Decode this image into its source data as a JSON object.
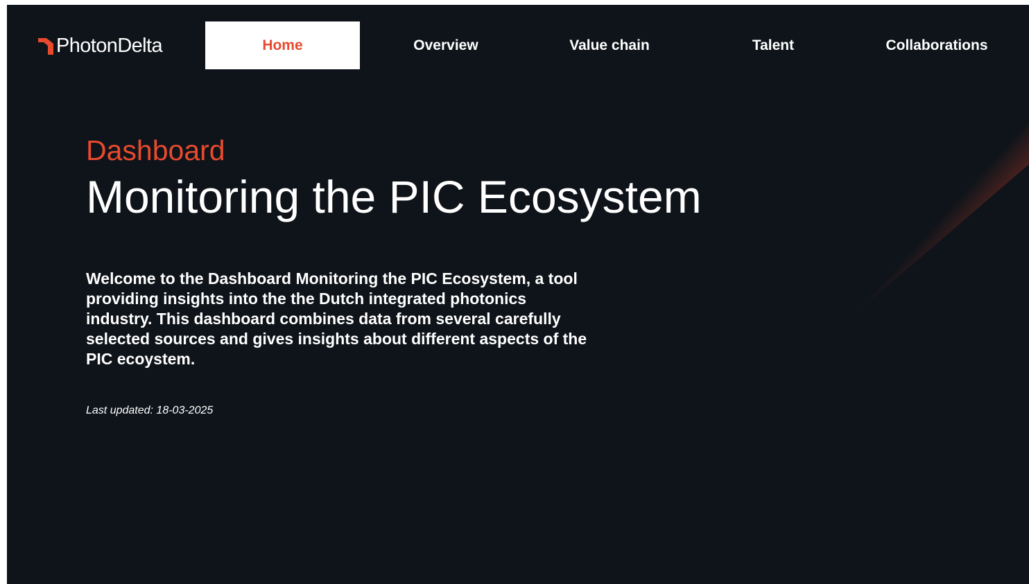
{
  "brand": {
    "logo_text": "PhotonDelta",
    "accent_color": "#e84a2e",
    "background_color": "#0f141a"
  },
  "nav": {
    "items": [
      {
        "label": "Home",
        "active": true
      },
      {
        "label": "Overview",
        "active": false
      },
      {
        "label": "Value chain",
        "active": false
      },
      {
        "label": "Talent",
        "active": false
      },
      {
        "label": "Collaborations",
        "active": false
      }
    ]
  },
  "hero": {
    "kicker": "Dashboard",
    "title": "Monitoring the PIC Ecosystem",
    "intro": "Welcome to the Dashboard Monitoring the PIC Ecosystem, a tool providing insights into the the Dutch integrated photonics industry. This dashboard combines data from several carefully selected sources and gives insights about different aspects of the PIC ecoystem.",
    "last_updated": "Last updated: 18-03-2025"
  },
  "decor": {
    "beam_icon": "diagonal-light-beam"
  }
}
